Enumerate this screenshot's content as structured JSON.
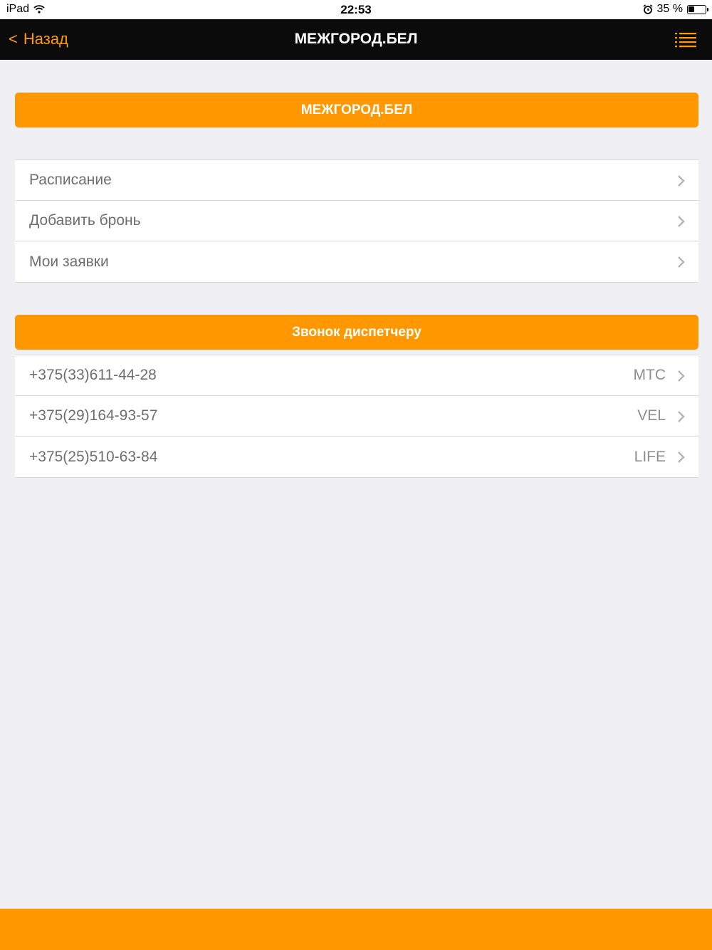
{
  "status_bar": {
    "device": "iPad",
    "time": "22:53",
    "battery": "35 %",
    "battery_level": 0.35
  },
  "nav": {
    "back_label": "Назад",
    "title": "МЕЖГОРОД.БЕЛ"
  },
  "header_button": {
    "label": "МЕЖГОРОД.БЕЛ"
  },
  "menu": [
    {
      "label": "Расписание"
    },
    {
      "label": "Добавить бронь"
    },
    {
      "label": "Мои заявки"
    }
  ],
  "dispatcher": {
    "label": "Звонок диспетчеру",
    "phones": [
      {
        "number": "+375(33)611-44-28",
        "operator": "MTC"
      },
      {
        "number": "+375(29)164-93-57",
        "operator": "VEL"
      },
      {
        "number": "+375(25)510-63-84",
        "operator": "LIFE"
      }
    ]
  },
  "colors": {
    "accent": "#ff9800",
    "nav_bg": "#0b0b0b",
    "page_bg": "#efeff4"
  }
}
